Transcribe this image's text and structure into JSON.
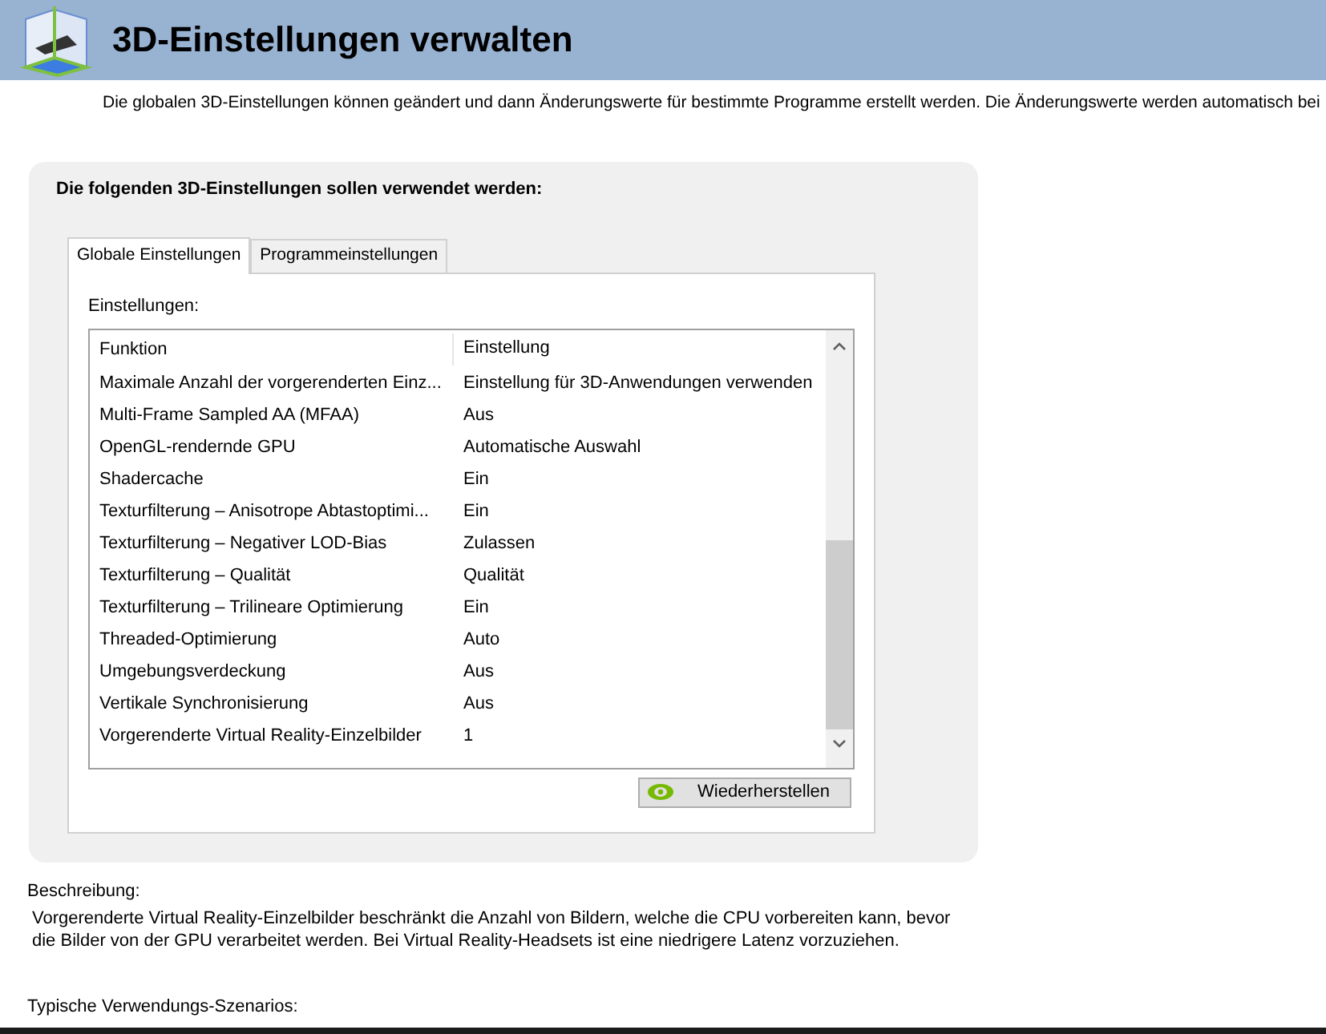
{
  "header": {
    "title": "3D-Einstellungen verwalten"
  },
  "intro": "Die globalen 3D-Einstellungen können geändert und dann Änderungswerte für bestimmte Programme erstellt werden. Die Änderungswerte werden automatisch bei",
  "panel": {
    "heading": "Die folgenden 3D-Einstellungen sollen verwendet werden:",
    "tabs": [
      {
        "label": "Globale Einstellungen",
        "selected": true
      },
      {
        "label": "Programmeinstellungen",
        "selected": false
      }
    ],
    "list_label": "Einstellungen:",
    "columns": [
      "Funktion",
      "Einstellung"
    ],
    "rows": [
      {
        "feature": "Maximale Anzahl der vorgerenderten Einz...",
        "setting": "Einstellung für 3D-Anwendungen verwenden"
      },
      {
        "feature": "Multi-Frame Sampled AA (MFAA)",
        "setting": "Aus"
      },
      {
        "feature": "OpenGL-rendernde GPU",
        "setting": "Automatische Auswahl"
      },
      {
        "feature": "Shadercache",
        "setting": "Ein"
      },
      {
        "feature": "Texturfilterung – Anisotrope Abtastoptimi...",
        "setting": "Ein"
      },
      {
        "feature": "Texturfilterung – Negativer LOD-Bias",
        "setting": "Zulassen"
      },
      {
        "feature": "Texturfilterung – Qualität",
        "setting": "Qualität"
      },
      {
        "feature": "Texturfilterung – Trilineare Optimierung",
        "setting": "Ein"
      },
      {
        "feature": "Threaded-Optimierung",
        "setting": "Auto"
      },
      {
        "feature": "Umgebungsverdeckung",
        "setting": "Aus"
      },
      {
        "feature": "Vertikale Synchronisierung",
        "setting": "Aus"
      },
      {
        "feature": "Vorgerenderte Virtual Reality-Einzelbilder",
        "setting": "1"
      }
    ],
    "restore_button": "Wiederherstellen"
  },
  "description": {
    "label": "Beschreibung:",
    "text": "Vorgerenderte Virtual Reality-Einzelbilder beschränkt die Anzahl von Bildern, welche die CPU vorbereiten kann, bevor die Bilder von der GPU verarbeitet werden. Bei Virtual Reality-Headsets ist eine niedrigere Latenz vorzuziehen."
  },
  "usage_label": "Typische Verwendungs-Szenarios:"
}
